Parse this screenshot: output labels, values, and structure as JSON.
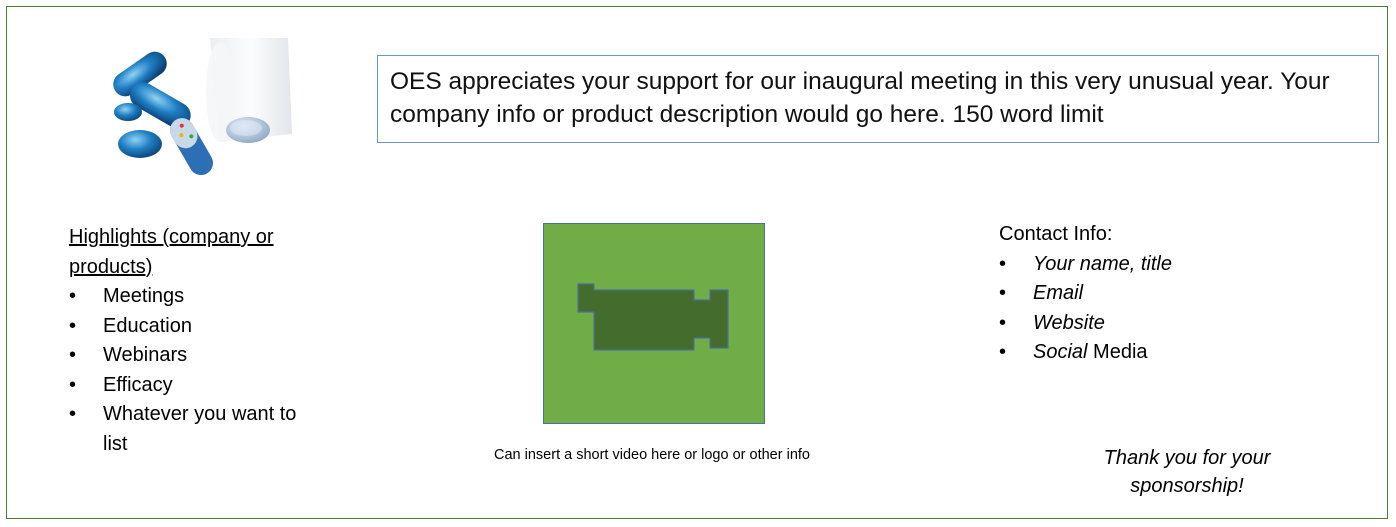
{
  "description": {
    "text": "OES appreciates your support for our inaugural meeting in this very unusual year. Your company info or product description would go here. 150 word limit"
  },
  "highlights": {
    "heading": "Highlights (company or products)",
    "items": [
      "Meetings",
      "Education",
      "Webinars",
      "Efficacy",
      "Whatever you want to list"
    ]
  },
  "video": {
    "caption": "Can insert a short video here or logo or other info",
    "icon": "video-camera-icon",
    "colors": {
      "background": "#70ad47",
      "icon": "#436c2d",
      "border": "#4b6fa0"
    }
  },
  "contact": {
    "heading": "Contact Info:",
    "items": [
      {
        "italic": "Your name, title",
        "plain": ""
      },
      {
        "italic": "Email",
        "plain": ""
      },
      {
        "italic": "Website",
        "plain": ""
      },
      {
        "italic": "Social",
        "plain": " Media"
      }
    ]
  },
  "thanks": {
    "text": "Thank you for your sponsorship!"
  },
  "colors": {
    "frame_border": "#4f7a34",
    "desc_border": "#6c98c6"
  }
}
